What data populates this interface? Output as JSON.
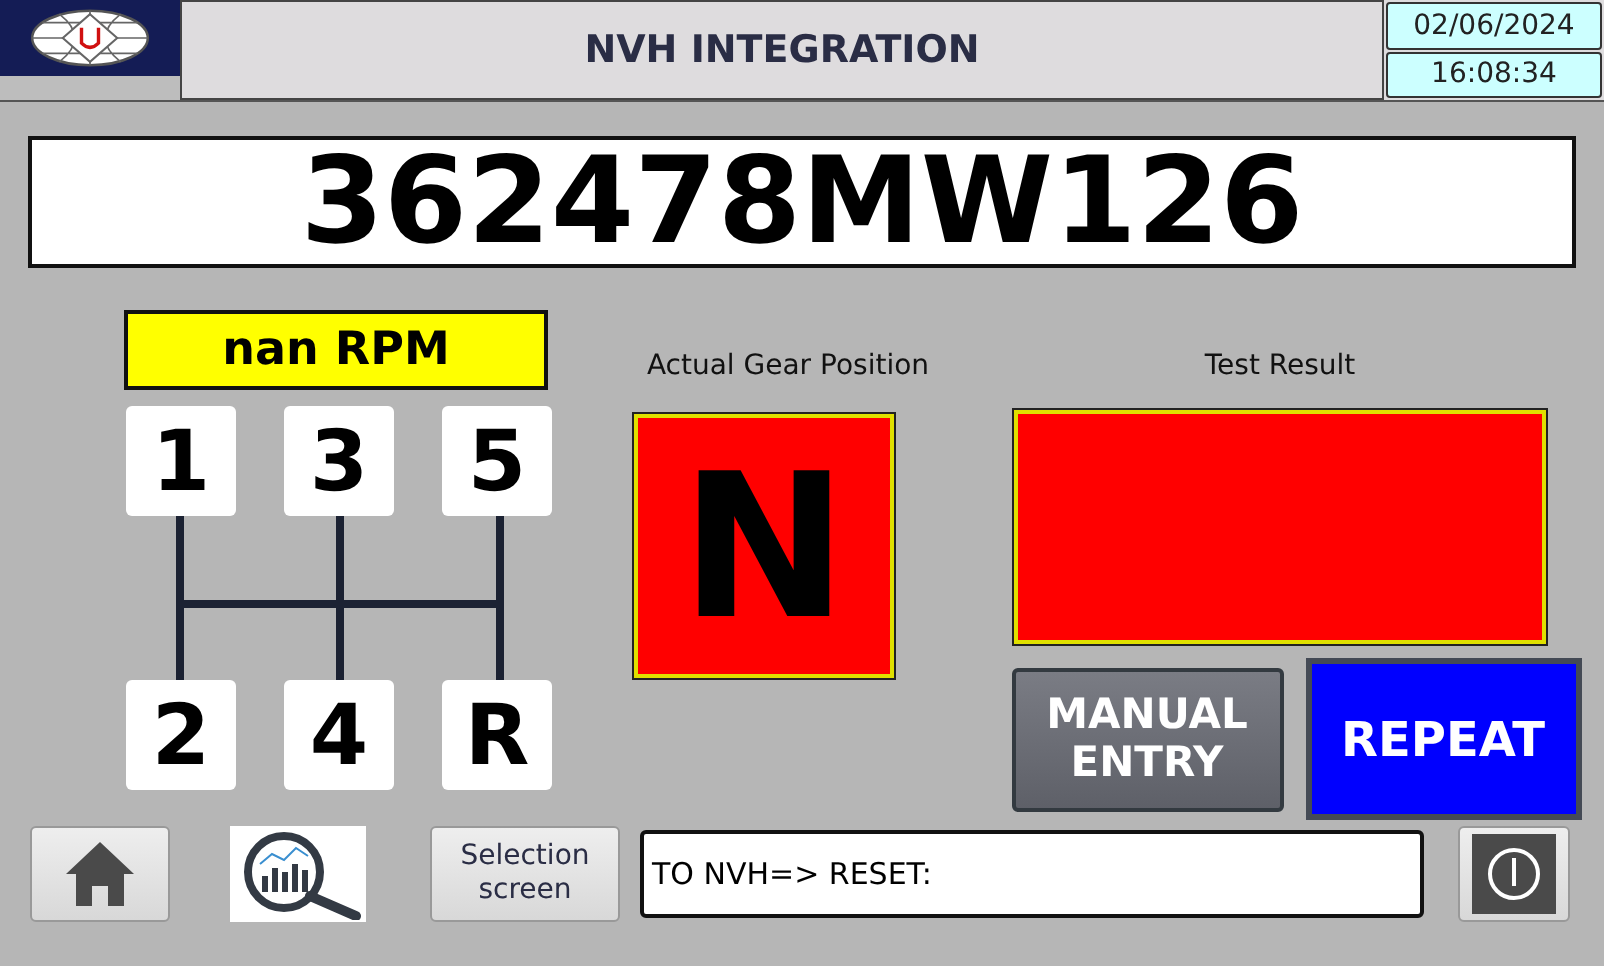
{
  "header": {
    "title": "NVH INTEGRATION",
    "date": "02/06/2024",
    "time": "16:08:34"
  },
  "serial": "362478MW126",
  "rpm": "nan RPM",
  "gears": [
    "1",
    "3",
    "5",
    "2",
    "4",
    "R"
  ],
  "gear_position": {
    "label": "Actual Gear Position",
    "value": "N"
  },
  "test_result": {
    "label": "Test Result"
  },
  "buttons": [
    {
      "label": "MANUAL ENTRY",
      "kind": "manual"
    },
    {
      "label": "REPEAT",
      "kind": "repeat"
    }
  ],
  "bottom_bar": {
    "selection_button": "Selection screen",
    "message": "TO NVH=> RESET:"
  }
}
